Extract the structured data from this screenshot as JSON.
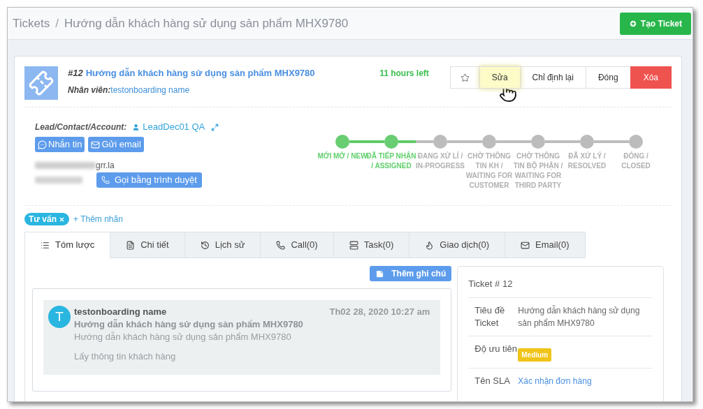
{
  "breadcrumb": {
    "items": [
      "Tickets",
      "Hướng dẫn khách hàng sử dụng sản phẩm MHX9780"
    ],
    "separator": "/"
  },
  "create_button": {
    "label": "Tạo Ticket"
  },
  "ticket": {
    "number": "#12",
    "title": "Hướng dẫn khách hàng sử dụng sản phẩm MHX9780",
    "assignee_label": "Nhân viên:",
    "assignee": "testonboarding name",
    "time_left": "11 hours left"
  },
  "actions": [
    {
      "kind": "star",
      "highlighted": false
    },
    {
      "kind": "default",
      "label": "Sửa",
      "highlighted": true
    },
    {
      "kind": "default",
      "label": "Chỉ định lại",
      "highlighted": false
    },
    {
      "kind": "default",
      "label": "Đóng",
      "highlighted": false
    },
    {
      "kind": "danger",
      "label": "Xóa",
      "highlighted": false
    }
  ],
  "contact": {
    "label": "Lead/Contact/Account:",
    "name": "LeadDec01 QA",
    "buttons": [
      "Nhắn tin",
      "Gửi email"
    ],
    "email_visible": "grr.la",
    "call_button": "Gọi bằng trình duyệt"
  },
  "status_steps": [
    {
      "label": "MỚI MỞ / NEW",
      "done": true
    },
    {
      "label": "ĐÃ TIẾP NHẬN / ASSIGNED",
      "done": true
    },
    {
      "label": "ĐANG XỬ LÍ / IN-PROGRESS",
      "done": false
    },
    {
      "label": "CHỜ THÔNG TIN KH / WAITING FOR CUSTOMER",
      "done": false
    },
    {
      "label": "CHỜ THÔNG TIN BỘ PHẬN / WAITING FOR THIRD PARTY",
      "done": false
    },
    {
      "label": "ĐÃ XỬ LÝ / RESOLVED",
      "done": false
    },
    {
      "label": "ĐÓNG / CLOSED",
      "done": false
    }
  ],
  "tags": [
    {
      "label": "Tư vấn"
    }
  ],
  "add_tag": "+ Thêm nhãn",
  "tabs": [
    {
      "label": "Tóm lược",
      "selected": true
    },
    {
      "label": "Chi tiết",
      "selected": false
    },
    {
      "label": "Lịch sử",
      "selected": false
    },
    {
      "label": "Call(0)",
      "selected": false
    },
    {
      "label": "Task(0)",
      "selected": false
    },
    {
      "label": "Giao dịch(0)",
      "selected": false
    },
    {
      "label": "Email(0)",
      "selected": false
    }
  ],
  "add_note_button": "Thêm ghi chú",
  "notes": [
    {
      "avatar": "T",
      "author": "testonboarding name",
      "date": "Th02 28, 2020 10:27 am",
      "title": "Hướng dẫn khách hàng sử dụng sản phẩm MHX9780",
      "body": "Hướng dẫn khách hàng sử dụng sản phẩm MHX9780",
      "extra": "Lấy thông tin khách hàng"
    }
  ],
  "ticket_panel": {
    "title": "Ticket # 12",
    "rows": [
      {
        "label": "Tiêu đề Ticket",
        "value": "Hướng dẫn khách hàng sử dụng sản phẩm MHX9780",
        "kind": "text"
      },
      {
        "label": "Độ ưu tiên",
        "value": "Medium",
        "kind": "badge"
      },
      {
        "label": "Tên SLA",
        "value": "Xác nhận đơn hàng",
        "kind": "link"
      }
    ]
  }
}
